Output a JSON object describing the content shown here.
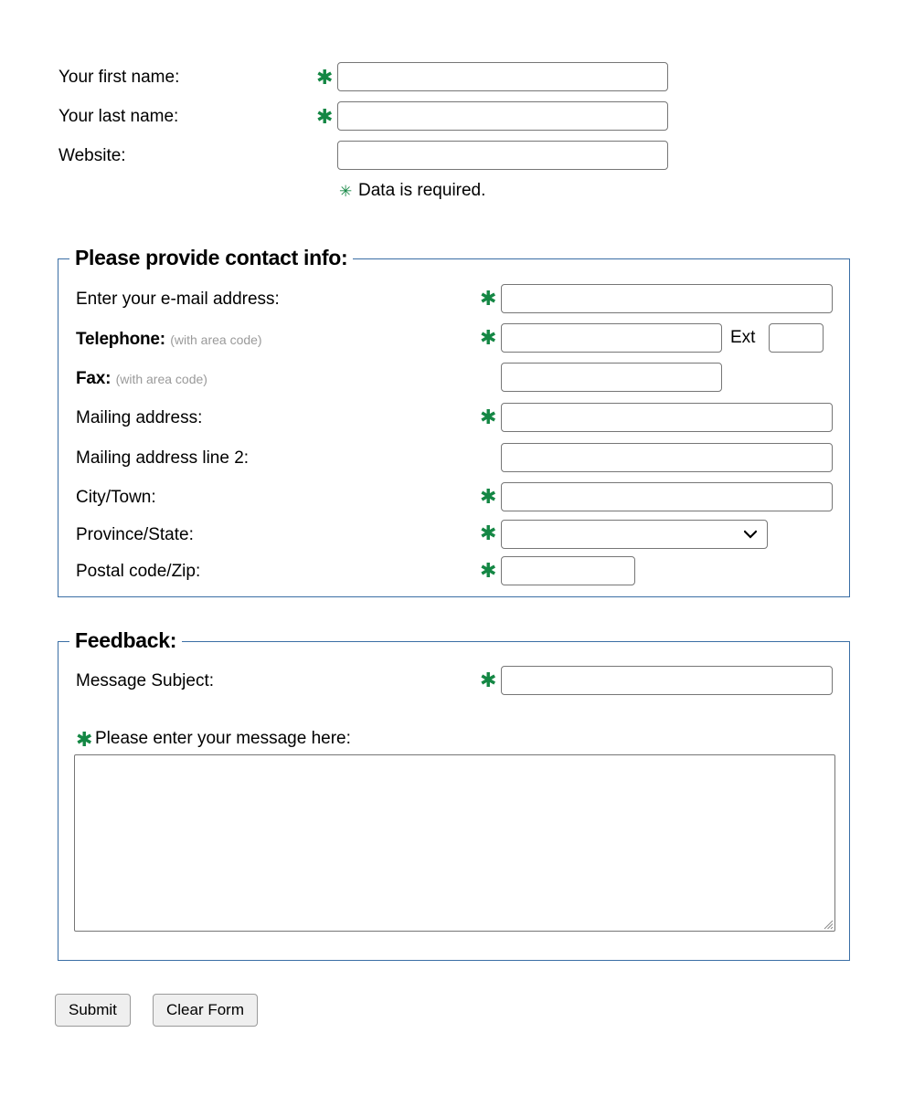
{
  "form": {
    "required_marker": "✱",
    "required_marker_small": "✳",
    "accent_green": "#148744",
    "fieldset_border": "#3a6ea5",
    "input_border": "#767676",
    "required_note": "Data is required.",
    "top_fields": [
      {
        "label": "Your first name:",
        "required": true,
        "value": "",
        "placeholder": ""
      },
      {
        "label": "Your last name:",
        "required": true,
        "value": "",
        "placeholder": ""
      },
      {
        "label": "Website:",
        "required": false,
        "value": "",
        "placeholder": ""
      }
    ],
    "contact": {
      "legend": "Please provide contact info:",
      "email_label": "Enter your e-mail address:",
      "email_value": "",
      "telephone_label": "Telephone:",
      "telephone_hint": "(with area code)",
      "telephone_value": "",
      "ext_label": "Ext",
      "ext_value": "",
      "fax_label": "Fax:",
      "fax_hint": "(with area code)",
      "fax_value": "",
      "address1_label": "Mailing address:",
      "address1_value": "",
      "address2_label": "Mailing address line 2:",
      "address2_value": "",
      "city_label": "City/Town:",
      "city_value": "",
      "province_label": "Province/State:",
      "province_selected": "",
      "province_options": [
        ""
      ],
      "postal_label": "Postal code/Zip:",
      "postal_value": ""
    },
    "feedback": {
      "legend": "Feedback:",
      "subject_label": "Message Subject:",
      "subject_value": "",
      "message_label": "Please enter your message here:",
      "message_value": ""
    },
    "buttons": {
      "submit": "Submit",
      "clear": "Clear Form"
    }
  }
}
